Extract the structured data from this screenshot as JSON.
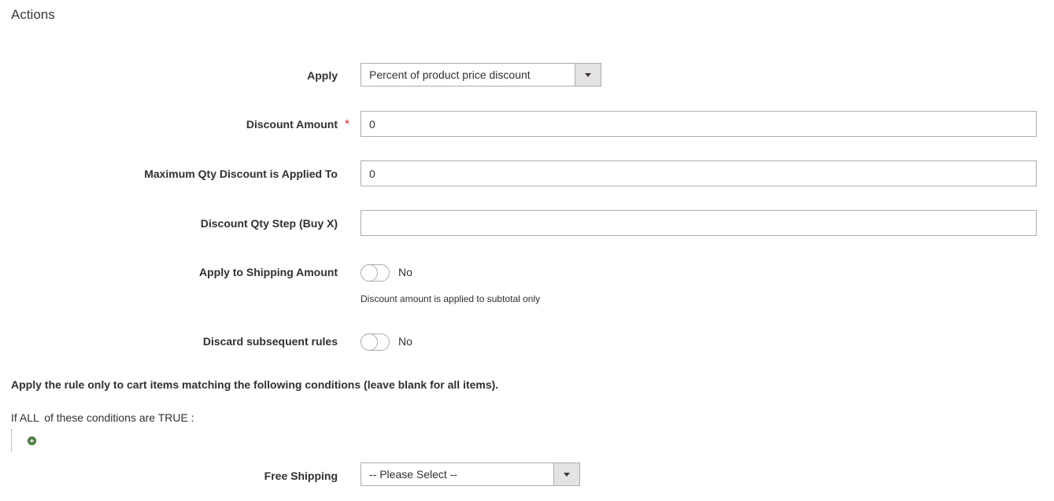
{
  "section": {
    "title": "Actions"
  },
  "apply": {
    "label": "Apply",
    "value": "Percent of product price discount"
  },
  "discount_amount": {
    "label": "Discount Amount",
    "required": "*",
    "value": "0"
  },
  "max_qty": {
    "label": "Maximum Qty Discount is Applied To",
    "value": "0"
  },
  "qty_step": {
    "label": "Discount Qty Step (Buy X)",
    "value": ""
  },
  "apply_shipping": {
    "label": "Apply to Shipping Amount",
    "state": "No",
    "note": "Discount amount is applied to subtotal only"
  },
  "discard_rules": {
    "label": "Discard subsequent rules",
    "state": "No"
  },
  "conditions": {
    "instruction": "Apply the rule only to cart items matching the following conditions (leave blank for all items).",
    "prefix": "If",
    "aggregator": "ALL",
    "middle": "of these conditions are",
    "value": "TRUE",
    "suffix": ":"
  },
  "free_shipping": {
    "label": "Free Shipping",
    "value": "-- Please Select --"
  }
}
